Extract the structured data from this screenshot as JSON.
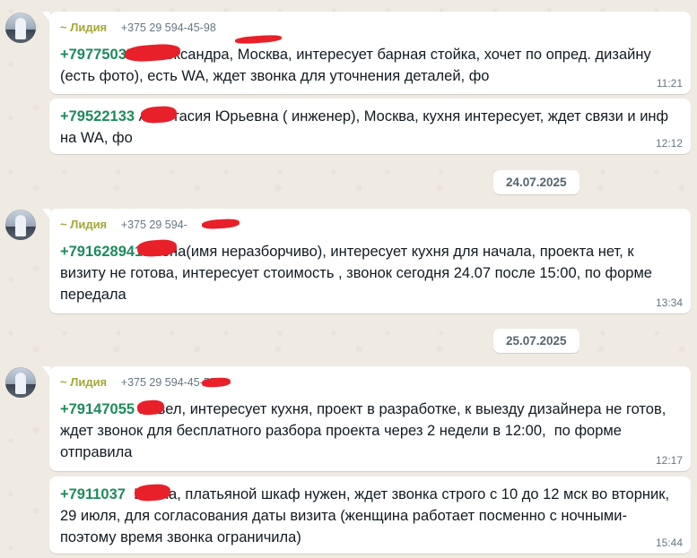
{
  "sender": {
    "name": "~ Лидия",
    "phone_1": "+375 29 594-45-98",
    "phone_2": "+375 29 594-",
    "phone_3": "+375 29 594-45-55"
  },
  "dates": [
    "24.07.2025",
    "25.07.2025"
  ],
  "messages": [
    {
      "phone": "+797750355",
      "text": " Александра, Москва, интересует барная стойка, хочет по опред. дизайну (есть фото), есть WA, ждет звонка для уточнения деталей, фо",
      "time": "11:21"
    },
    {
      "phone": "+79522133",
      "text": " Анастасия Юрьевна ( инженер), Москва, кухня интересует, ждет связи и инф на WA, фо",
      "time": "12:12"
    },
    {
      "phone": "+791628941",
      "text": "Елена(имя неразборчиво), интересует кухня для начала, проекта нет, к визиту не готова, интересует стоимость , звонок сегодня 24.07 после 15:00, по форме передала",
      "time": "13:34"
    },
    {
      "phone": "+79147055",
      "text": " Павел, интересует кухня, проект в разработке, к выезду дизайнера не готов, ждет звонок для бесплатного разбора проекта через 2 недели в 12:00,  по форме отправила",
      "time": "12:17"
    },
    {
      "phone": "+7911037",
      "text": "  Елена, платьяной шкаф нужен, ждет звонка строго с 10 до 12 мск во вторник, 29 июля, для согласования даты визита (женщина работает посменно с ночными-поэтому время звонка ограничила)",
      "time": "15:44"
    }
  ]
}
